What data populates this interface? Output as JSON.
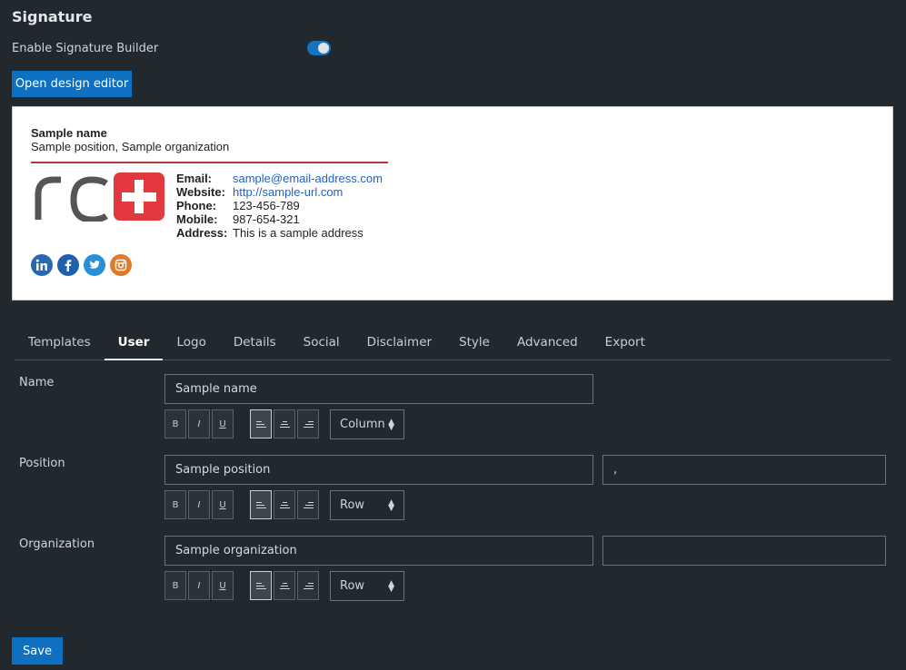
{
  "title": "Signature",
  "enable_label": "Enable Signature Builder",
  "enable_on": true,
  "open_editor_label": "Open design editor",
  "signature": {
    "name": "Sample name",
    "position_line": "Sample position, Sample organization",
    "logo_text": "rc+",
    "contacts": [
      {
        "label": "Email:",
        "value": "sample@email-address.com",
        "link": true
      },
      {
        "label": "Website:",
        "value": "http://sample-url.com",
        "link": true
      },
      {
        "label": "Phone:",
        "value": "123-456-789",
        "link": false
      },
      {
        "label": "Mobile:",
        "value": "987-654-321",
        "link": false
      },
      {
        "label": "Address:",
        "value": "This is a sample address",
        "link": false
      }
    ],
    "socials": [
      {
        "name": "linkedin-icon",
        "glyph": "in",
        "color": "#2867b2"
      },
      {
        "name": "facebook-icon",
        "glyph": "f",
        "color": "#1f5fb0"
      },
      {
        "name": "twitter-icon",
        "glyph": "t",
        "color": "#2a8fd8"
      },
      {
        "name": "instagram-icon",
        "glyph": "◎",
        "color": "#e07a2a"
      }
    ]
  },
  "tabs": [
    {
      "label": "Templates",
      "active": false
    },
    {
      "label": "User",
      "active": true
    },
    {
      "label": "Logo",
      "active": false
    },
    {
      "label": "Details",
      "active": false
    },
    {
      "label": "Social",
      "active": false
    },
    {
      "label": "Disclaimer",
      "active": false
    },
    {
      "label": "Style",
      "active": false
    },
    {
      "label": "Advanced",
      "active": false
    },
    {
      "label": "Export",
      "active": false
    }
  ],
  "fields": {
    "name": {
      "label": "Name",
      "value": "Sample name",
      "layout": "Column"
    },
    "position": {
      "label": "Position",
      "value": "Sample position",
      "separator": ",",
      "layout": "Row"
    },
    "organization": {
      "label": "Organization",
      "value": "Sample organization",
      "separator": "",
      "layout": "Row"
    }
  },
  "format_buttons": {
    "bold": "B",
    "italic": "I",
    "underline": "U"
  },
  "save_label": "Save",
  "colors": {
    "accent": "#0d70c0",
    "divider": "#b23a3f",
    "background": "#22292e"
  }
}
